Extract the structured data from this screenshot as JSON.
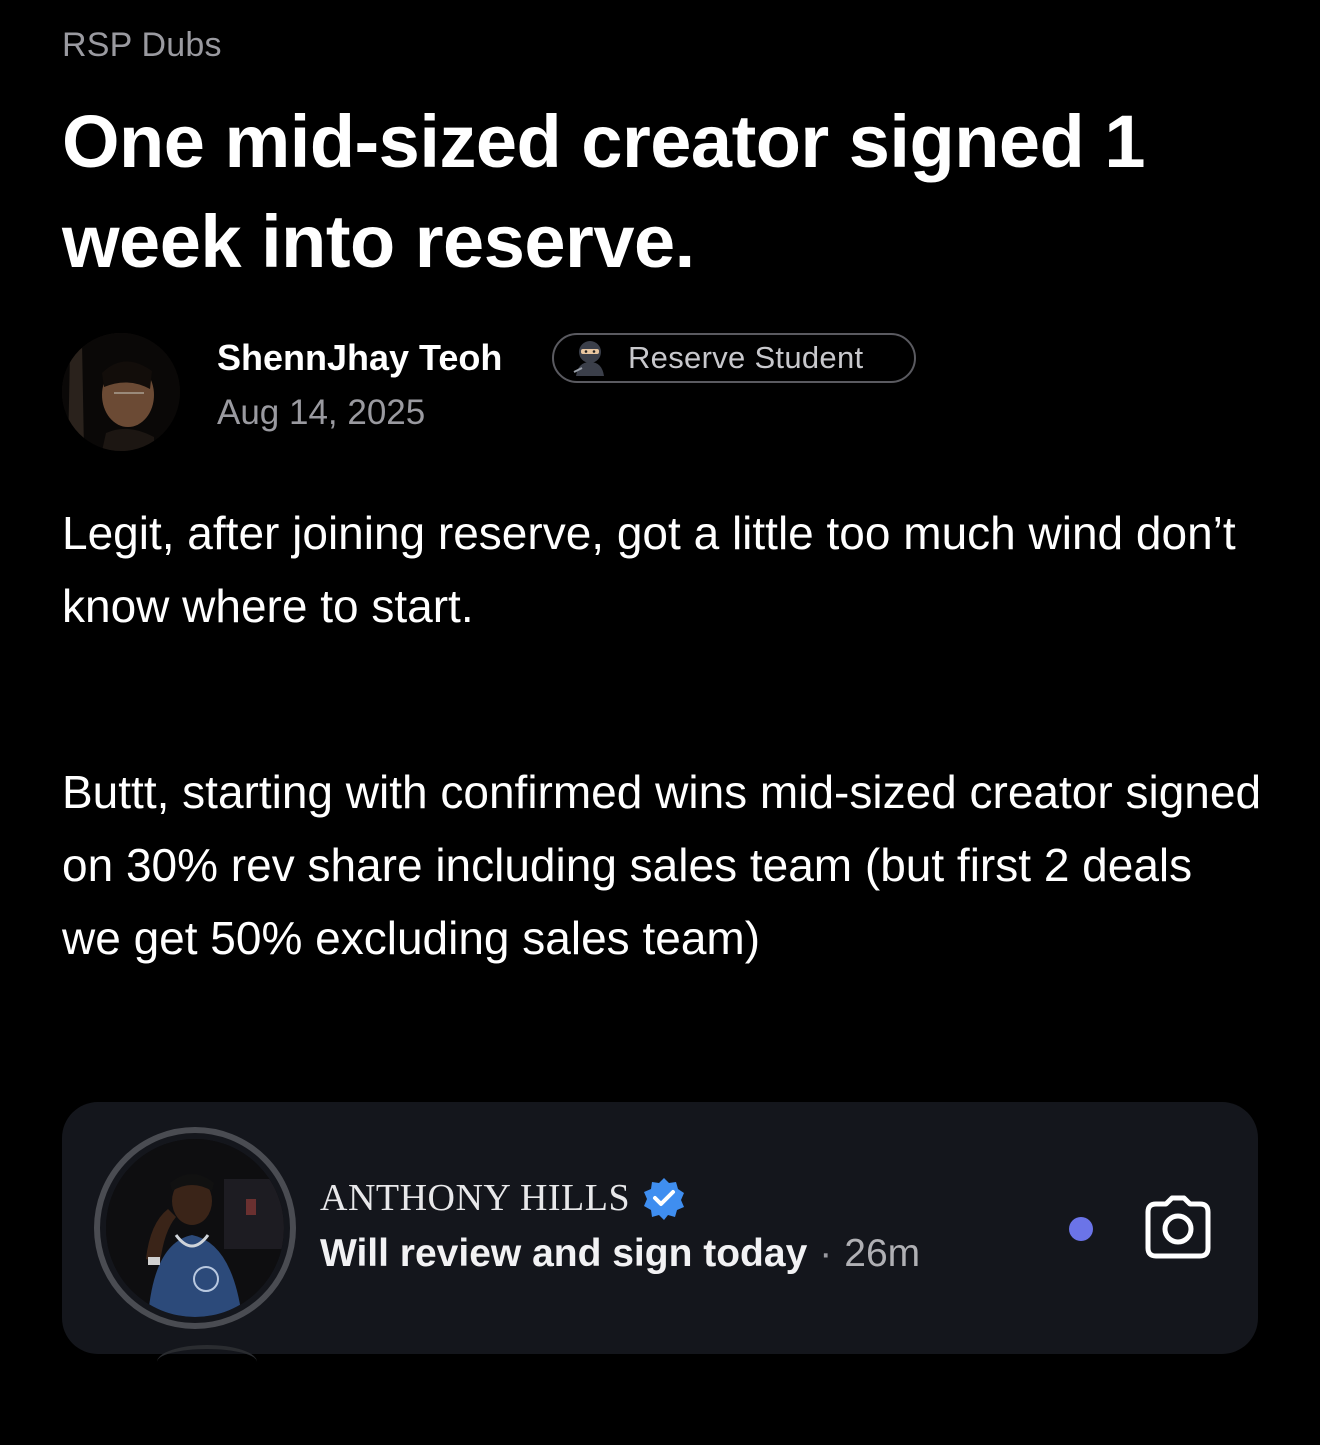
{
  "post": {
    "category": "RSP Dubs",
    "title": "One mid-sized creator signed 1 week into reserve.",
    "author": {
      "name": "ShennJhay Teoh",
      "badge_icon": "ninja-emoji-icon",
      "badge_label": "Reserve Student",
      "date": "Aug 14, 2025"
    },
    "paragraphs": [
      "Legit, after joining reserve, got a little too much wind don’t know where to start.",
      "Buttt, starting with confirmed wins mid-sized creator signed on 30% rev share including sales team (but first 2 deals we get 50% excluding sales team)"
    ]
  },
  "embed": {
    "name": "ANTHONY HILLS",
    "verified_icon": "verified-badge-icon",
    "message": "Will review and sign today",
    "separator": "·",
    "time": "26m",
    "unread_color": "#6b74e8",
    "camera_icon": "camera-icon"
  }
}
